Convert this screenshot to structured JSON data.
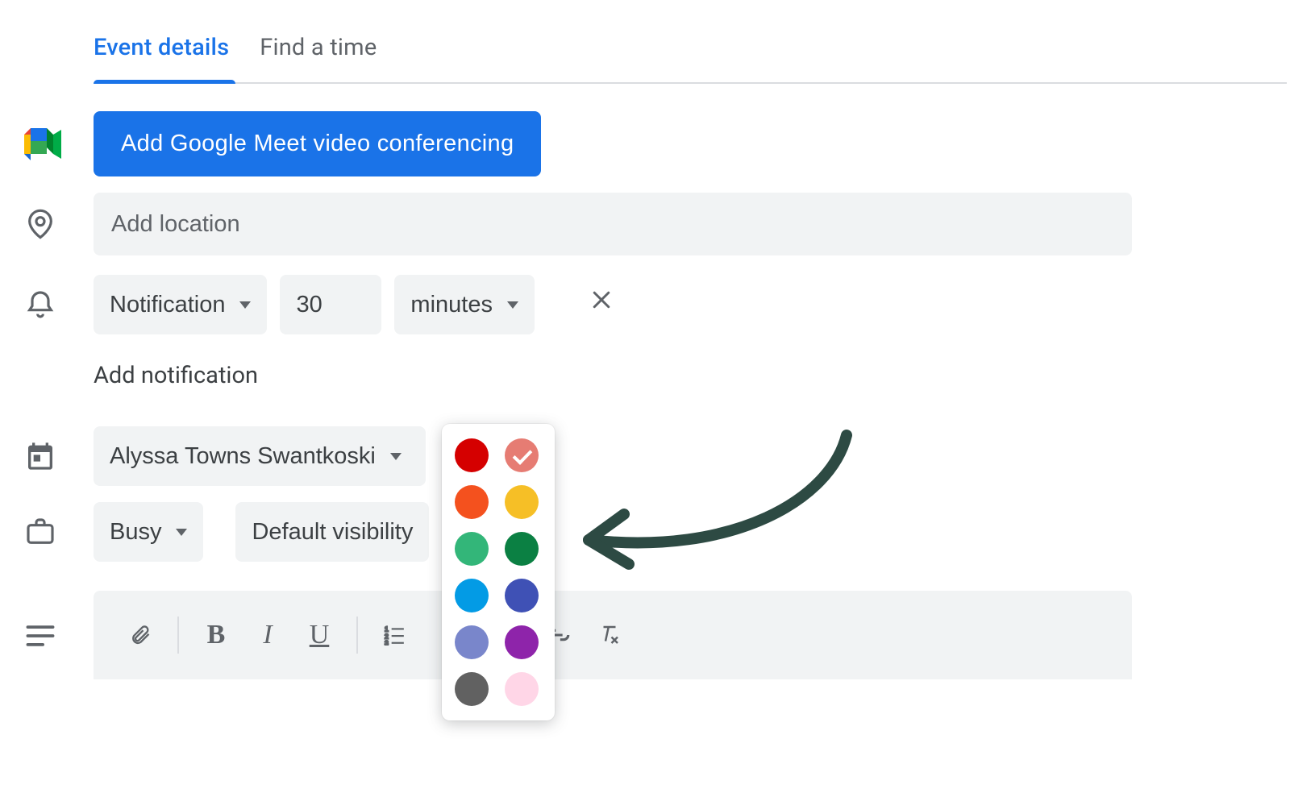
{
  "tabs": {
    "event_details": "Event details",
    "find_a_time": "Find a time"
  },
  "meet_button": "Add Google Meet video conferencing",
  "location_placeholder": "Add location",
  "notification": {
    "type_label": "Notification",
    "amount": "30",
    "unit_label": "minutes"
  },
  "add_notification_label": "Add notification",
  "calendar_name": "Alyssa Towns Swantkoski",
  "availability_label": "Busy",
  "visibility_label": "Default visibility",
  "toolbar": {
    "bold": "B",
    "italic": "I",
    "underline": "U"
  },
  "colors": [
    {
      "name": "tomato",
      "hex": "#d50000",
      "selected": false
    },
    {
      "name": "flamingo",
      "hex": "#e67c73",
      "selected": true
    },
    {
      "name": "tangerine",
      "hex": "#f4511e",
      "selected": false
    },
    {
      "name": "banana",
      "hex": "#f6bf26",
      "selected": false
    },
    {
      "name": "sage",
      "hex": "#33b679",
      "selected": false
    },
    {
      "name": "basil",
      "hex": "#0b8043",
      "selected": false
    },
    {
      "name": "peacock",
      "hex": "#039be5",
      "selected": false
    },
    {
      "name": "blueberry",
      "hex": "#3f51b5",
      "selected": false
    },
    {
      "name": "lavender",
      "hex": "#7986cb",
      "selected": false
    },
    {
      "name": "grape",
      "hex": "#8e24aa",
      "selected": false
    },
    {
      "name": "graphite",
      "hex": "#616161",
      "selected": false
    },
    {
      "name": "light-pink",
      "hex": "#ffd6e7",
      "selected": false
    }
  ]
}
